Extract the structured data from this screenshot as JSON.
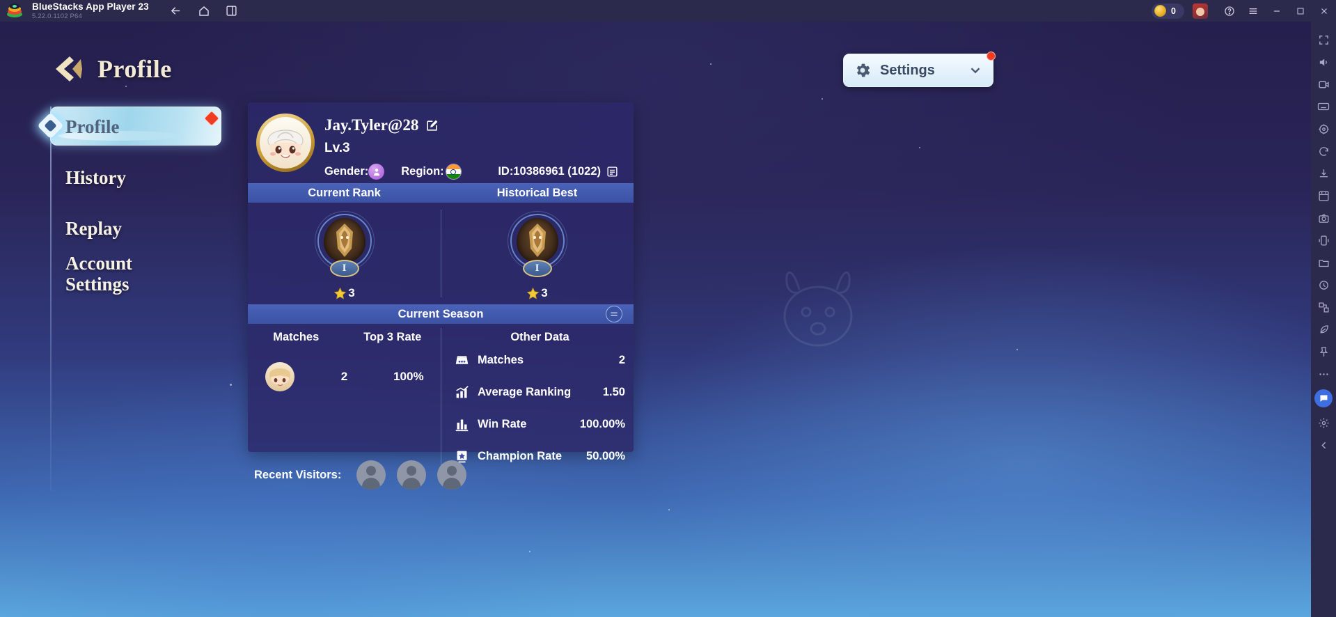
{
  "titlebar": {
    "app_name": "BlueStacks App Player 23",
    "version": "5.22.0.1102  P64",
    "logo_icon": "bluestacks-logo",
    "back_icon": "back-arrow-icon",
    "home_icon": "home-icon",
    "multi_instance_icon": "multi-instance-icon",
    "coin_icon": "coin-icon",
    "coin_value": "0",
    "profile_avatar_icon": "user-avatar-icon",
    "help_icon": "help-icon",
    "menu_icon": "hamburger-menu-icon",
    "minimize_icon": "minimize-icon",
    "maximize_icon": "maximize-icon",
    "close_icon": "close-icon"
  },
  "right_toolbar": {
    "items": [
      "fullscreen-icon",
      "volume-icon",
      "video-icon",
      "keyboard-icon",
      "location-icon",
      "rotate-icon",
      "install-apk-icon",
      "screenshot-icon",
      "camera-icon",
      "shake-icon",
      "media-manager-icon",
      "macro-icon",
      "multi-instance-sync-icon",
      "eco-mode-icon",
      "pin-icon",
      "more-icon"
    ],
    "chat_icon": "chat-icon",
    "settings_icon": "gear-icon",
    "collapse_icon": "collapse-icon"
  },
  "header": {
    "title": "Profile",
    "back_icon": "back-chevron-icon"
  },
  "settings": {
    "label": "Settings",
    "gear_icon": "gear-icon",
    "chevron_icon": "chevron-down-icon",
    "badge_visible": true
  },
  "sidebar": {
    "items": [
      {
        "label": "Profile",
        "active": true,
        "badge": true
      },
      {
        "label": "History",
        "active": false,
        "badge": false
      },
      {
        "label": "Replay",
        "active": false,
        "badge": false
      },
      {
        "label": "Account Settings",
        "active": false,
        "badge": false
      }
    ],
    "active_diamond_icon": "diamond-marker-icon"
  },
  "profile": {
    "avatar_icon": "player-avatar",
    "username": "Jay.Tyler@28",
    "edit_icon": "edit-pencil-icon",
    "level": "Lv.3",
    "gender_label": "Gender:",
    "gender_icon": "gender-unknown-icon",
    "region_label": "Region:",
    "region_icon": "india-flag-icon",
    "id_text": "ID:10386961 (1022)",
    "copy_icon": "copy-icon"
  },
  "rank": {
    "headers": [
      "Current Rank",
      "Historical Best"
    ],
    "entries": [
      {
        "tier": "I",
        "stars": "3",
        "medal_icon": "eagle-rank-medal",
        "star_icon": "star-icon"
      },
      {
        "tier": "I",
        "stars": "3",
        "medal_icon": "eagle-rank-medal",
        "star_icon": "star-icon"
      }
    ]
  },
  "season": {
    "title": "Current Season",
    "toggle_icon": "swap-season-icon",
    "left_headers": [
      "Matches",
      "Top 3 Rate"
    ],
    "hero_icon": "hero-portrait",
    "left_values": [
      "2",
      "100%"
    ],
    "other_title": "Other Data",
    "other_rows": [
      {
        "icon": "scoreboard-icon",
        "label": "Matches",
        "value": "2"
      },
      {
        "icon": "trend-up-icon",
        "label": "Average Ranking",
        "value": "1.50"
      },
      {
        "icon": "bar-chart-icon",
        "label": "Win Rate",
        "value": "100.00%"
      },
      {
        "icon": "certificate-star-icon",
        "label": "Champion Rate",
        "value": "50.00%"
      }
    ]
  },
  "visitors": {
    "label": "Recent Visitors:",
    "avatars": [
      "visitor-avatar",
      "visitor-avatar",
      "visitor-avatar"
    ]
  },
  "colors": {
    "accent_red": "#ef3c23",
    "band_blue": "#3b52a4",
    "card_bg": "#2c2869",
    "gold": "#d9c285"
  }
}
